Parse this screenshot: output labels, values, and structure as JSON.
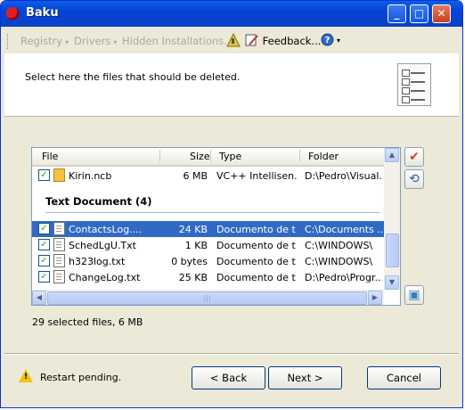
{
  "window": {
    "title": "Baku"
  },
  "titlebar_buttons": {
    "minimize": "_",
    "maximize": "□",
    "close": "✕"
  },
  "toolbar": {
    "items": [
      {
        "label": "Registry",
        "arrow": "▾",
        "enabled": false
      },
      {
        "label": "Drivers",
        "arrow": "▾",
        "enabled": false
      },
      {
        "label": "Hidden Installations...",
        "arrow": "",
        "enabled": false
      },
      {
        "label": "Feedback...",
        "arrow": "",
        "enabled": true
      },
      {
        "label": "",
        "arrow": "▾",
        "enabled": true
      }
    ],
    "icons": [
      "wand-icon",
      "feedback-pen-icon",
      "help-icon"
    ]
  },
  "banner": {
    "instruction": "Select here the files that should be deleted.",
    "icon": "checklist-icon"
  },
  "file_list": {
    "columns": [
      "File",
      "Size",
      "Type",
      "Folder"
    ],
    "rows_before_group": [
      {
        "checked": true,
        "name": "Kirin.ncb",
        "size": "6 MB",
        "type": "VC++ Intellisen...",
        "folder": "D:\\Pedro\\Visual...",
        "icon": "ncb-file-icon"
      }
    ],
    "group": {
      "title": "Text Document (4)",
      "rows": [
        {
          "checked": true,
          "name": "ContactsLog....",
          "size": "24 KB",
          "type": "Documento de t...",
          "folder": "C:\\Documents ...",
          "selected": true
        },
        {
          "checked": true,
          "name": "SchedLgU.Txt",
          "size": "1 KB",
          "type": "Documento de t...",
          "folder": "C:\\WINDOWS\\",
          "selected": false
        },
        {
          "checked": true,
          "name": "h323log.txt",
          "size": "0 bytes",
          "type": "Documento de t...",
          "folder": "C:\\WINDOWS\\",
          "selected": false
        },
        {
          "checked": true,
          "name": "ChangeLog.txt",
          "size": "25 KB",
          "type": "Documento de t...",
          "folder": "D:\\Pedro\\Progr...",
          "selected": false
        }
      ]
    },
    "check_mark": "✓",
    "scroll_up": "▲",
    "scroll_down": "▼",
    "scroll_left": "◀",
    "scroll_right": "▶",
    "thumb_grip": "|||"
  },
  "side_buttons": [
    {
      "name": "check-all",
      "glyph": "✔",
      "color": "#d9401f"
    },
    {
      "name": "undo",
      "glyph": "⟲",
      "color": "#2d5a9e"
    },
    {
      "name": "properties",
      "glyph": "▣",
      "color": "#3a7cc4"
    }
  ],
  "status": {
    "summary": "29 selected files, 6 MB"
  },
  "footer": {
    "warning": "Restart pending.",
    "warning_icon": "warning-icon",
    "buttons": {
      "back": "< Back",
      "next": "Next >",
      "cancel": "Cancel"
    }
  }
}
